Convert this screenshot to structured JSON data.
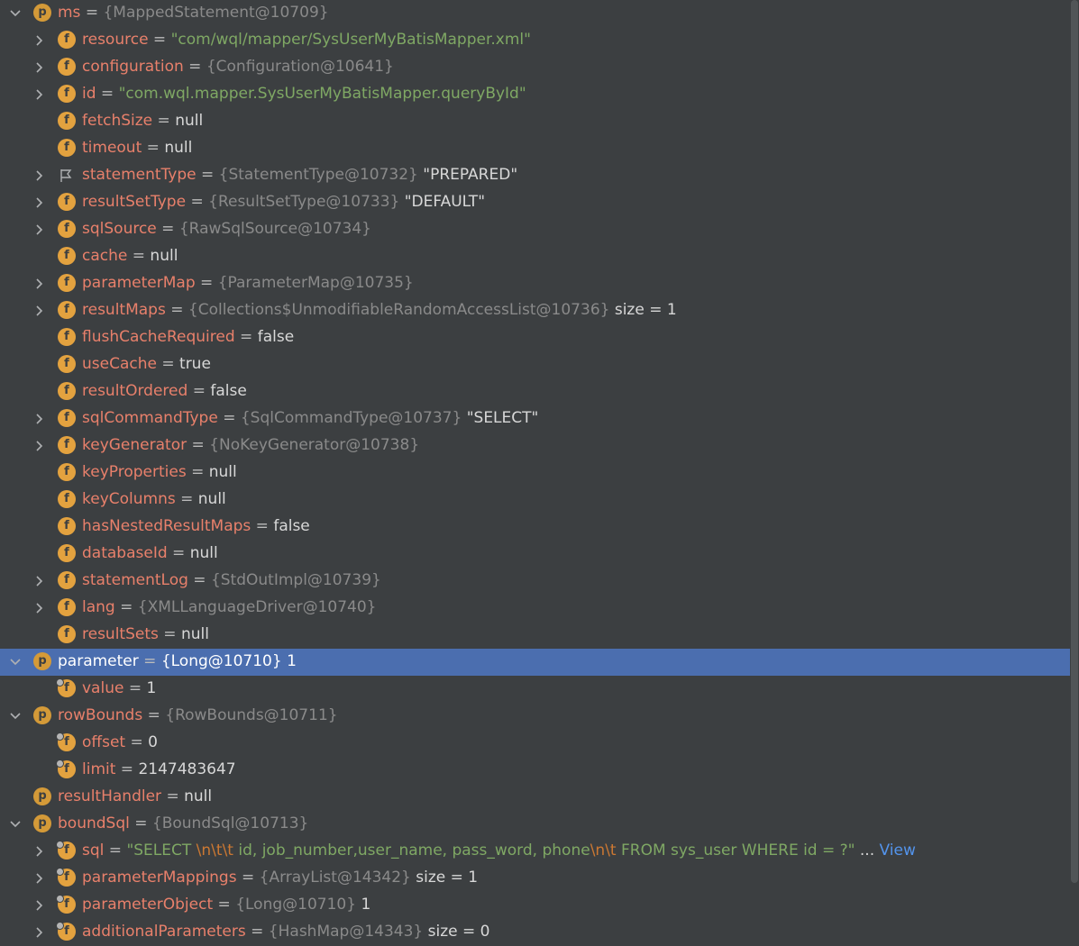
{
  "variables": [
    {
      "depth": 0,
      "expanded": true,
      "icon": "p",
      "name": "ms",
      "type": "{MappedStatement@10709}"
    },
    {
      "depth": 1,
      "expandable": true,
      "icon": "f",
      "name": "resource",
      "str": "\"com/wql/mapper/SysUserMyBatisMapper.xml\""
    },
    {
      "depth": 1,
      "expandable": true,
      "icon": "f",
      "name": "configuration",
      "type": "{Configuration@10641}"
    },
    {
      "depth": 1,
      "expandable": true,
      "icon": "f",
      "name": "id",
      "str": "\"com.wql.mapper.SysUserMyBatisMapper.queryById\""
    },
    {
      "depth": 1,
      "icon": "f",
      "name": "fetchSize",
      "val": "null"
    },
    {
      "depth": 1,
      "icon": "f",
      "name": "timeout",
      "val": "null"
    },
    {
      "depth": 1,
      "expandable": true,
      "icon": "flag",
      "name": "statementType",
      "type": "{StatementType@10732}",
      "val": "\"PREPARED\""
    },
    {
      "depth": 1,
      "expandable": true,
      "icon": "f",
      "name": "resultSetType",
      "type": "{ResultSetType@10733}",
      "val": "\"DEFAULT\""
    },
    {
      "depth": 1,
      "expandable": true,
      "icon": "f",
      "name": "sqlSource",
      "type": "{RawSqlSource@10734}"
    },
    {
      "depth": 1,
      "icon": "f",
      "name": "cache",
      "val": "null"
    },
    {
      "depth": 1,
      "expandable": true,
      "icon": "f",
      "name": "parameterMap",
      "type": "{ParameterMap@10735}"
    },
    {
      "depth": 1,
      "expandable": true,
      "icon": "f",
      "name": "resultMaps",
      "type": "{Collections$UnmodifiableRandomAccessList@10736}",
      "val": " size = 1"
    },
    {
      "depth": 1,
      "icon": "f",
      "name": "flushCacheRequired",
      "val": "false"
    },
    {
      "depth": 1,
      "icon": "f",
      "name": "useCache",
      "val": "true"
    },
    {
      "depth": 1,
      "icon": "f",
      "name": "resultOrdered",
      "val": "false"
    },
    {
      "depth": 1,
      "expandable": true,
      "icon": "f",
      "name": "sqlCommandType",
      "type": "{SqlCommandType@10737}",
      "val": "\"SELECT\""
    },
    {
      "depth": 1,
      "expandable": true,
      "icon": "f",
      "name": "keyGenerator",
      "type": "{NoKeyGenerator@10738}"
    },
    {
      "depth": 1,
      "icon": "f",
      "name": "keyProperties",
      "val": "null"
    },
    {
      "depth": 1,
      "icon": "f",
      "name": "keyColumns",
      "val": "null"
    },
    {
      "depth": 1,
      "icon": "f",
      "name": "hasNestedResultMaps",
      "val": "false"
    },
    {
      "depth": 1,
      "icon": "f",
      "name": "databaseId",
      "val": "null"
    },
    {
      "depth": 1,
      "expandable": true,
      "icon": "f",
      "name": "statementLog",
      "type": "{StdOutImpl@10739}"
    },
    {
      "depth": 1,
      "expandable": true,
      "icon": "f",
      "name": "lang",
      "type": "{XMLLanguageDriver@10740}"
    },
    {
      "depth": 1,
      "icon": "f",
      "name": "resultSets",
      "val": "null"
    },
    {
      "depth": 0,
      "expanded": true,
      "selected": true,
      "icon": "p",
      "name": "parameter",
      "type": "{Long@10710}",
      "val": "1"
    },
    {
      "depth": 1,
      "icon": "f",
      "final": true,
      "name": "value",
      "val": "1"
    },
    {
      "depth": 0,
      "expanded": true,
      "icon": "p",
      "name": "rowBounds",
      "type": "{RowBounds@10711}"
    },
    {
      "depth": 1,
      "icon": "f",
      "final": true,
      "name": "offset",
      "val": "0"
    },
    {
      "depth": 1,
      "icon": "f",
      "final": true,
      "name": "limit",
      "val": "2147483647"
    },
    {
      "depth": 0,
      "icon": "p",
      "name": "resultHandler",
      "val": "null"
    },
    {
      "depth": 0,
      "expanded": true,
      "icon": "p",
      "name": "boundSql",
      "type": "{BoundSql@10713}"
    },
    {
      "depth": 1,
      "expandable": true,
      "icon": "f",
      "final": true,
      "name": "sql",
      "parts": [
        {
          "k": "str",
          "v": "\"SELECT "
        },
        {
          "k": "esc",
          "v": "\\n\\t\\t"
        },
        {
          "k": "str",
          "v": " id, job_number,user_name, pass_word, phone"
        },
        {
          "k": "esc",
          "v": "\\n\\t"
        },
        {
          "k": "str",
          "v": "  FROM sys_user WHERE id = ?\""
        },
        {
          "k": "val",
          "v": " ... "
        },
        {
          "k": "link",
          "v": "View"
        }
      ]
    },
    {
      "depth": 1,
      "expandable": true,
      "icon": "f",
      "final": true,
      "name": "parameterMappings",
      "type": "{ArrayList@14342}",
      "val": " size = 1"
    },
    {
      "depth": 1,
      "expandable": true,
      "icon": "f",
      "final": true,
      "name": "parameterObject",
      "type": "{Long@10710}",
      "val": "1"
    },
    {
      "depth": 1,
      "expandable": true,
      "icon": "f",
      "final": true,
      "name": "additionalParameters",
      "type": "{HashMap@14343}",
      "val": " size = 0"
    }
  ],
  "colors": {
    "background": "#3c3f41",
    "selection": "#4b6eaf",
    "field_name": "#e8806b",
    "string_value": "#7fa864",
    "type_ref": "#8a8a8a",
    "link": "#5394ec"
  },
  "icons": {
    "p": "parameter-icon",
    "f": "field-icon",
    "flag": "enum-flag-icon",
    "chevron": "chevron-icon"
  }
}
